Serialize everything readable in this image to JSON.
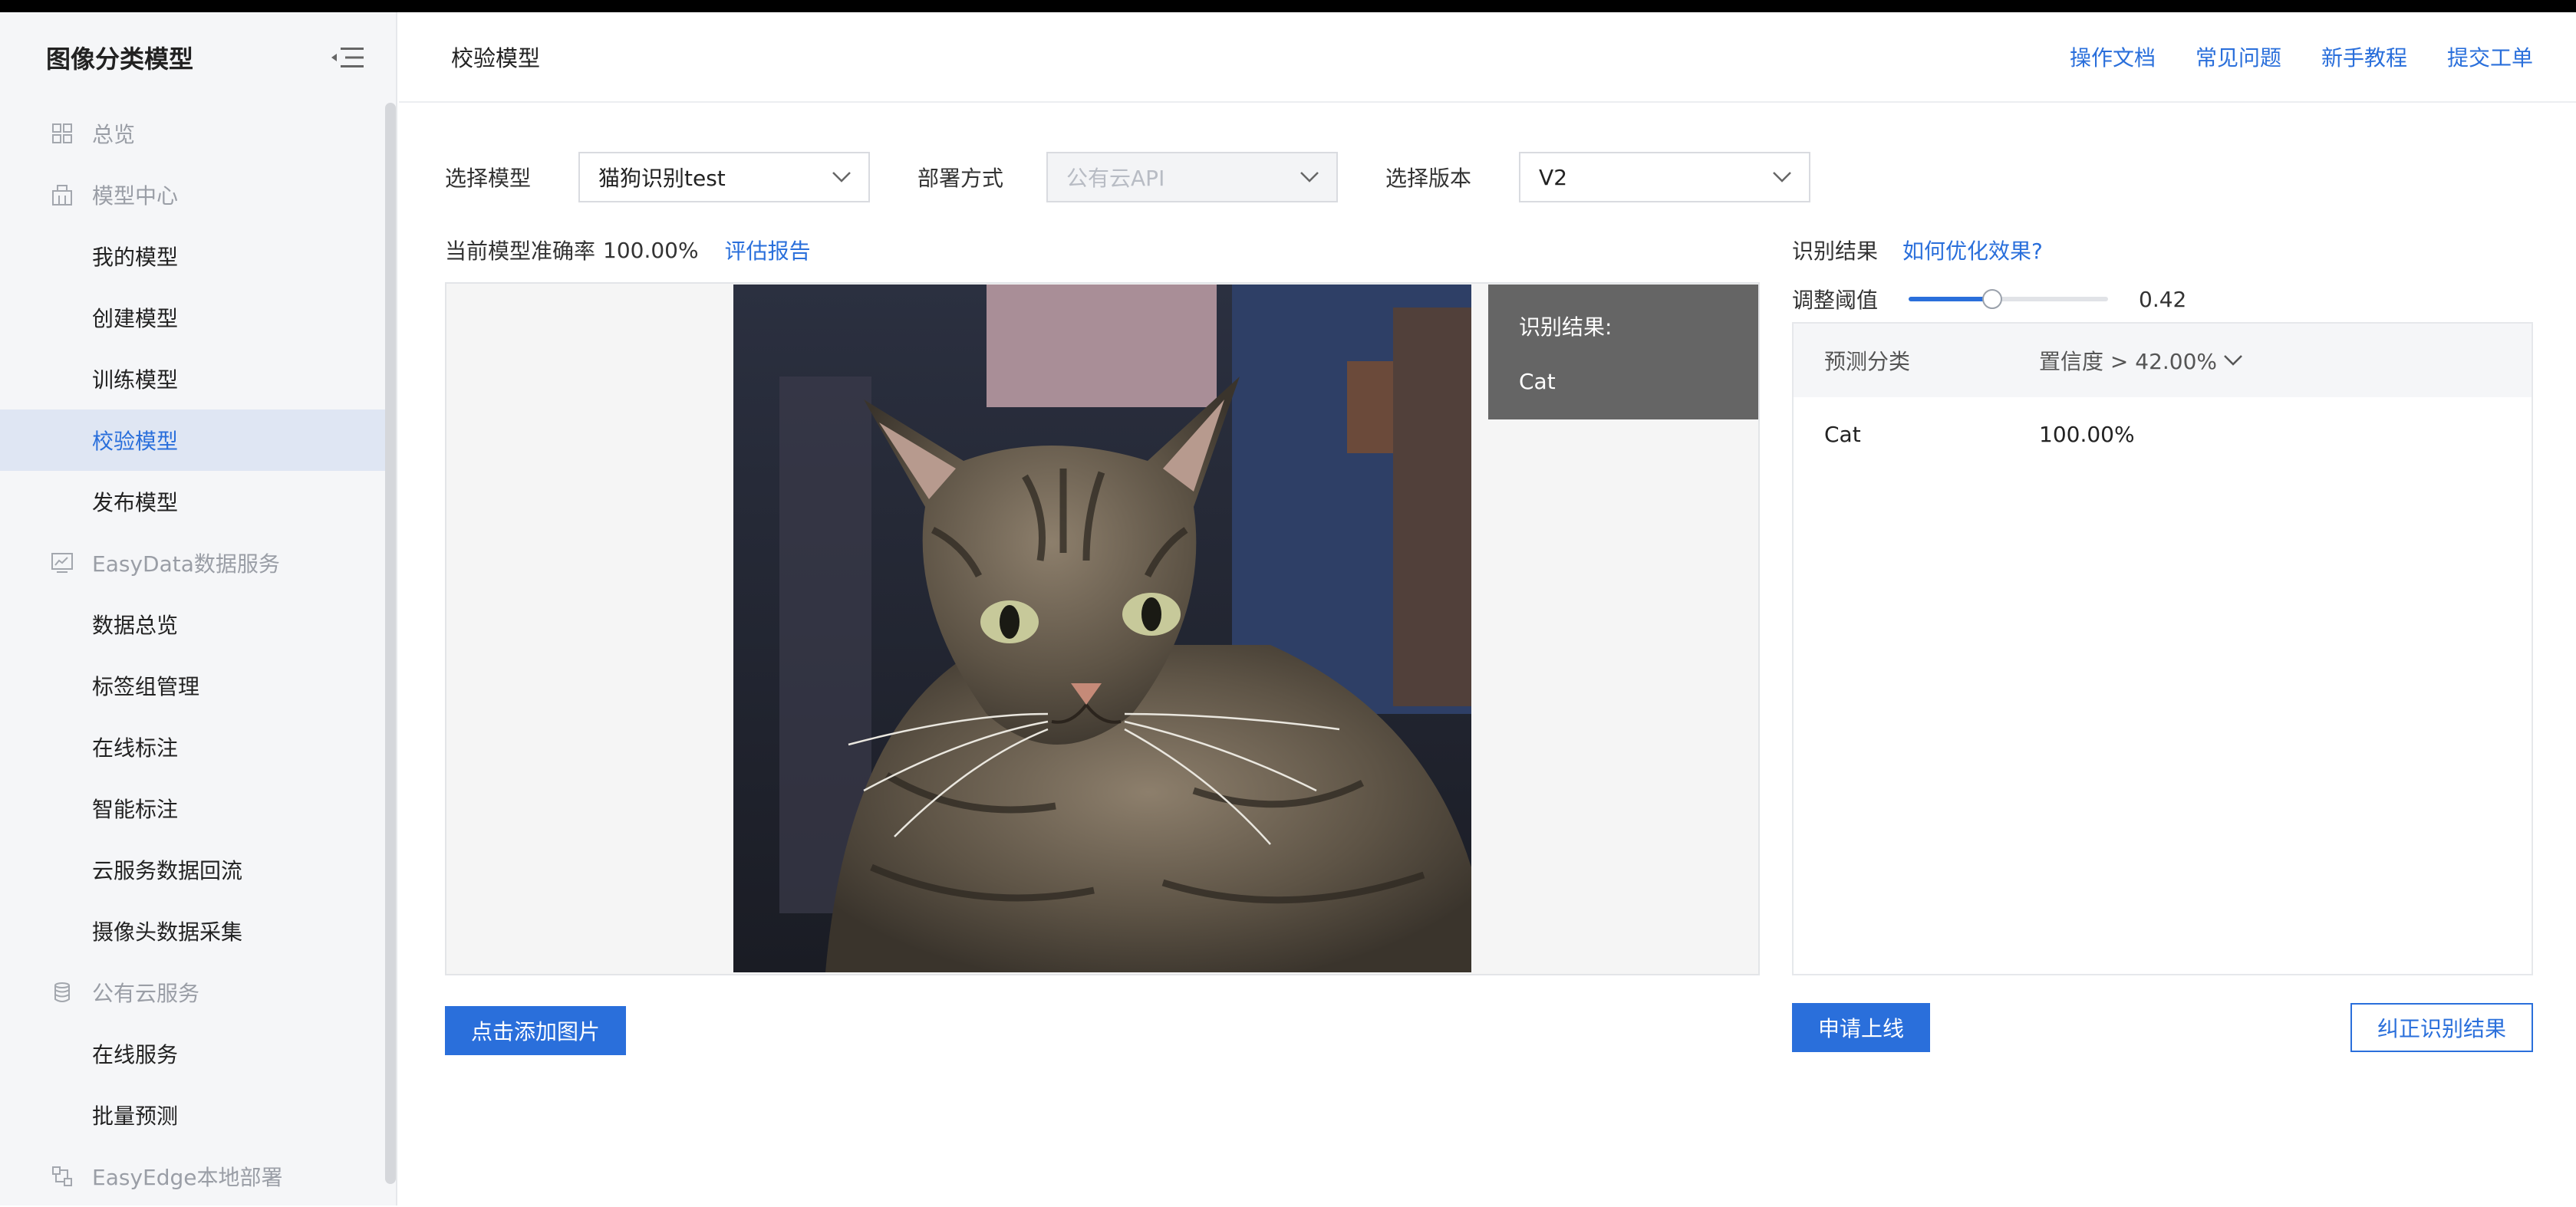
{
  "sidebar": {
    "title": "图像分类模型",
    "items": [
      {
        "label": "总览",
        "type": "group"
      },
      {
        "label": "模型中心",
        "type": "group"
      },
      {
        "label": "我的模型",
        "type": "sub"
      },
      {
        "label": "创建模型",
        "type": "sub"
      },
      {
        "label": "训练模型",
        "type": "sub"
      },
      {
        "label": "校验模型",
        "type": "sub",
        "active": true
      },
      {
        "label": "发布模型",
        "type": "sub"
      },
      {
        "label": "EasyData数据服务",
        "type": "group"
      },
      {
        "label": "数据总览",
        "type": "sub"
      },
      {
        "label": "标签组管理",
        "type": "sub"
      },
      {
        "label": "在线标注",
        "type": "sub"
      },
      {
        "label": "智能标注",
        "type": "sub"
      },
      {
        "label": "云服务数据回流",
        "type": "sub"
      },
      {
        "label": "摄像头数据采集",
        "type": "sub"
      },
      {
        "label": "公有云服务",
        "type": "group"
      },
      {
        "label": "在线服务",
        "type": "sub"
      },
      {
        "label": "批量预测",
        "type": "sub"
      },
      {
        "label": "EasyEdge本地部署",
        "type": "group"
      }
    ]
  },
  "header": {
    "title": "校验模型",
    "links": [
      "操作文档",
      "常见问题",
      "新手教程",
      "提交工单"
    ]
  },
  "form": {
    "model_label": "选择模型",
    "model_value": "猫狗识别test",
    "deploy_label": "部署方式",
    "deploy_value": "公有云API",
    "version_label": "选择版本",
    "version_value": "V2"
  },
  "accuracy": {
    "label": "当前模型准确率",
    "value": "100.00%",
    "report_link": "评估报告"
  },
  "preview": {
    "overlay_title": "识别结果:",
    "overlay_value": "Cat",
    "add_image_button": "点击添加图片"
  },
  "result": {
    "title": "识别结果",
    "optimize_link": "如何优化效果?",
    "threshold_label": "调整阈值",
    "threshold_value": "0.42",
    "threshold_fraction": 0.42,
    "col_category": "预测分类",
    "col_confidence": "置信度 > 42.00%",
    "rows": [
      {
        "category": "Cat",
        "confidence": "100.00%"
      }
    ],
    "apply_button": "申请上线",
    "correct_button": "纠正识别结果"
  },
  "colors": {
    "accent": "#2a6fdb",
    "sidebar_bg": "#f5f6f8",
    "active_bg": "#dfe6f3",
    "overlay_bg": "#656565"
  }
}
